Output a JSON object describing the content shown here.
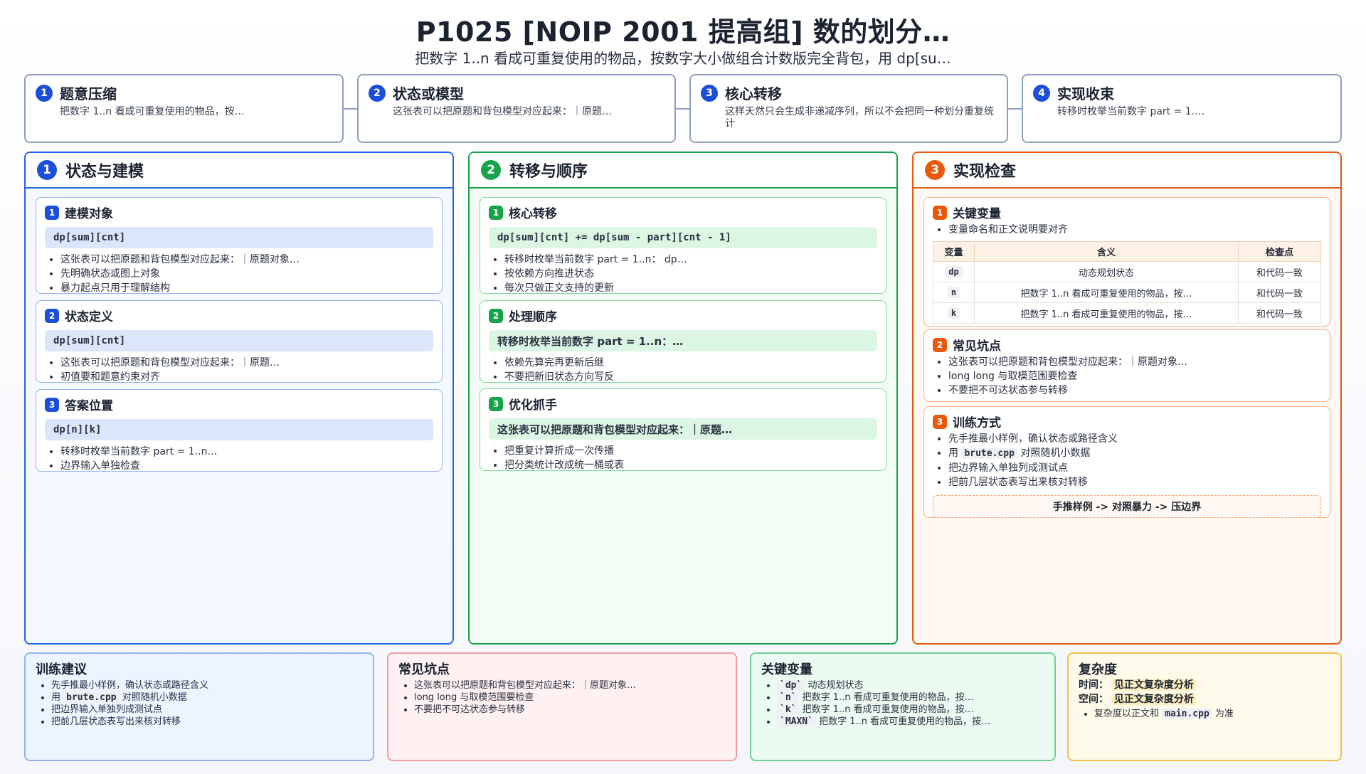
{
  "header": {
    "title": "P1025 [NOIP 2001 提高组] 数的划分…",
    "subtitle": "把数字 1..n 看成可重复使用的物品，按数字大小做组合计数版完全背包，用 dp[su…"
  },
  "steps": [
    {
      "num": "1",
      "title": "题意压缩",
      "text": "把数字 1..n 看成可重复使用的物品，按…"
    },
    {
      "num": "2",
      "title": "状态或模型",
      "text": "这张表可以把原题和背包模型对应起来：｜原题…"
    },
    {
      "num": "3",
      "title": "核心转移",
      "text": "这样天然只会生成非递减序列，所以不会把同一种划分重复统计"
    },
    {
      "num": "4",
      "title": "实现收束",
      "text": "转移时枚举当前数字 part = 1.…"
    }
  ],
  "columns": {
    "state": {
      "num": "1",
      "title": "状态与建模",
      "cards": [
        {
          "num": "1",
          "title": "建模对象",
          "code": "dp[sum][cnt]",
          "bullets": [
            "这张表可以把原题和背包模型对应起来：｜原题对象…",
            "先明确状态或图上对象",
            "暴力起点只用于理解结构"
          ]
        },
        {
          "num": "2",
          "title": "状态定义",
          "code": "dp[sum][cnt]",
          "bullets": [
            "这张表可以把原题和背包模型对应起来：｜原题…",
            "初值要和题意约束对齐"
          ]
        },
        {
          "num": "3",
          "title": "答案位置",
          "code": "dp[n][k]",
          "bullets": [
            "转移时枚举当前数字 part = 1..n…",
            "边界输入单独检查"
          ]
        }
      ]
    },
    "transition": {
      "num": "2",
      "title": "转移与顺序",
      "cards": [
        {
          "num": "1",
          "title": "核心转移",
          "code": "dp[sum][cnt] += dp[sum - part][cnt - 1]",
          "bullets": [
            "转移时枚举当前数字 part = 1..n：  dp…",
            "按依赖方向推进状态",
            "每次只做正文支持的更新"
          ]
        },
        {
          "num": "2",
          "title": "处理顺序",
          "code": "转移时枚举当前数字 part = 1..n：…",
          "bullets": [
            "依赖先算完再更新后继",
            "不要把新旧状态方向写反"
          ]
        },
        {
          "num": "3",
          "title": "优化抓手",
          "code": "这张表可以把原题和背包模型对应起来：｜原题…",
          "bullets": [
            "把重复计算折成一次传播",
            "把分类统计改成统一桶或表"
          ]
        }
      ]
    },
    "check": {
      "num": "3",
      "title": "实现检查",
      "vars_card": {
        "num": "1",
        "title": "关键变量",
        "note": "变量命名和正文说明要对齐",
        "headers": [
          "变量",
          "含义",
          "检查点"
        ],
        "rows": [
          {
            "var": "dp",
            "meaning": "动态规划状态",
            "check": "和代码一致"
          },
          {
            "var": "n",
            "meaning": "把数字 1..n 看成可重复使用的物品，按…",
            "check": "和代码一致"
          },
          {
            "var": "k",
            "meaning": "把数字 1..n 看成可重复使用的物品，按…",
            "check": "和代码一致"
          }
        ]
      },
      "pitfalls_card": {
        "num": "2",
        "title": "常见坑点",
        "bullets": [
          "这张表可以把原题和背包模型对应起来：｜原题对象…",
          "long long 与取模范围要检查",
          "不要把不可达状态参与转移"
        ]
      },
      "training_card": {
        "num": "3",
        "title": "训练方式",
        "b1": "先手推最小样例，确认状态或路径含义",
        "b2_pre": "用",
        "b2_code": "brute.cpp",
        "b2_post": "对照随机小数据",
        "b3": "把边界输入单独列成测试点",
        "b4": "把前几层状态表写出来核对转移",
        "tip": "手推样例 -> 对照暴力 -> 压边界"
      }
    }
  },
  "bottom": {
    "training": {
      "title": "训练建议",
      "b1": "先手推最小样例，确认状态或路径含义",
      "b2_pre": "用",
      "b2_code": "brute.cpp",
      "b2_post": "对照随机小数据",
      "b3": "把边界输入单独列成测试点",
      "b4": "把前几层状态表写出来核对转移"
    },
    "pitfalls": {
      "title": "常见坑点",
      "bullets": [
        "这张表可以把原题和背包模型对应起来：｜原题对象…",
        "long long 与取模范围要检查",
        "不要把不可达状态参与转移"
      ]
    },
    "vars": {
      "title": "关键变量",
      "items": [
        {
          "code": "`dp`",
          "text": "动态规划状态"
        },
        {
          "code": "`n`",
          "text": "把数字 1..n 看成可重复使用的物品，按…"
        },
        {
          "code": "`k`",
          "text": "把数字 1..n 看成可重复使用的物品，按…"
        },
        {
          "code": "`MAXN`",
          "text": "把数字 1..n 看成可重复使用的物品，按…"
        }
      ]
    },
    "complexity": {
      "title": "复杂度",
      "time_label": "时间：",
      "time_value": "见正文复杂度分析",
      "space_label": "空间：",
      "space_value": "见正文复杂度分析",
      "note_pre": "复杂度以正文和",
      "note_code": "main.cpp",
      "note_post": "为准"
    }
  },
  "colors": {
    "blue": "#2563eb",
    "green": "#16a34a",
    "orange": "#ea580c",
    "yellow": "#f0c248",
    "red": "#f0a0a6"
  }
}
